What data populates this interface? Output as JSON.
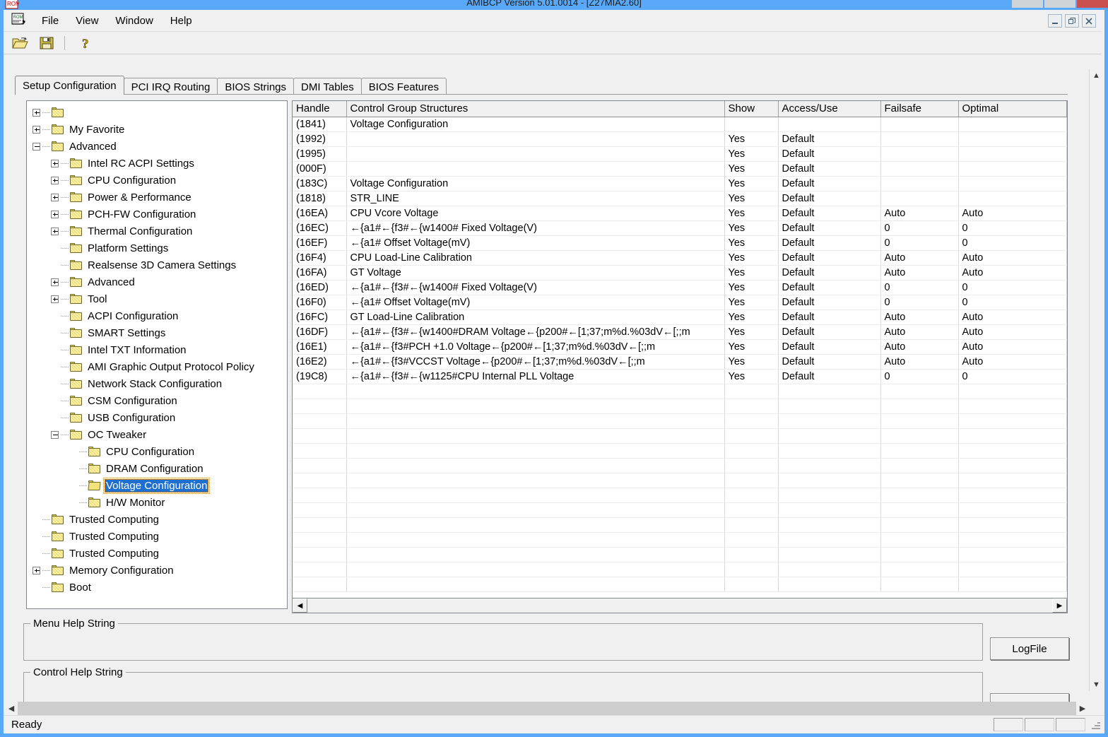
{
  "window": {
    "title": "AMIBCP Version 5.01.0014 - [Z27MIA2.60]",
    "app_icon": "rom-icon",
    "outer_buttons": [
      {
        "name": "minimize",
        "glyph": "–"
      },
      {
        "name": "maximize",
        "glyph": "❐"
      },
      {
        "name": "close",
        "glyph": "✕"
      }
    ]
  },
  "menu": {
    "doc_icon_label": "ROM",
    "items": [
      {
        "label": "File"
      },
      {
        "label": "View"
      },
      {
        "label": "Window"
      },
      {
        "label": "Help"
      }
    ]
  },
  "mdi_buttons": [
    {
      "name": "mdi-minimize",
      "glyph": "–"
    },
    {
      "name": "mdi-restore",
      "glyph": "❐"
    },
    {
      "name": "mdi-close",
      "glyph": "✕"
    }
  ],
  "toolbar": {
    "buttons": [
      {
        "name": "open-file-button",
        "icon": "open-folder-icon"
      },
      {
        "name": "save-file-button",
        "icon": "floppy-disk-icon"
      },
      {
        "name": "about-button",
        "icon": "question-mark-icon"
      }
    ]
  },
  "tabs": [
    {
      "label": "Setup Configuration",
      "active": true
    },
    {
      "label": "PCI IRQ Routing",
      "active": false
    },
    {
      "label": "BIOS Strings",
      "active": false
    },
    {
      "label": "DMI Tables",
      "active": false
    },
    {
      "label": "BIOS Features",
      "active": false
    }
  ],
  "tree": [
    {
      "label": "",
      "depth": 0,
      "toggle": "plus",
      "selected": false,
      "open": false
    },
    {
      "label": "My Favorite",
      "depth": 0,
      "toggle": "plus",
      "selected": false,
      "open": false
    },
    {
      "label": "Advanced",
      "depth": 0,
      "toggle": "minus",
      "selected": false,
      "open": false
    },
    {
      "label": "Intel RC ACPI Settings",
      "depth": 1,
      "toggle": "plus",
      "selected": false,
      "open": false
    },
    {
      "label": "CPU Configuration",
      "depth": 1,
      "toggle": "plus",
      "selected": false,
      "open": false
    },
    {
      "label": "Power & Performance",
      "depth": 1,
      "toggle": "plus",
      "selected": false,
      "open": false
    },
    {
      "label": "PCH-FW Configuration",
      "depth": 1,
      "toggle": "plus",
      "selected": false,
      "open": false
    },
    {
      "label": "Thermal Configuration",
      "depth": 1,
      "toggle": "plus",
      "selected": false,
      "open": false
    },
    {
      "label": "Platform Settings",
      "depth": 1,
      "toggle": "none",
      "selected": false,
      "open": false
    },
    {
      "label": "Realsense 3D Camera Settings",
      "depth": 1,
      "toggle": "none",
      "selected": false,
      "open": false
    },
    {
      "label": "Advanced",
      "depth": 1,
      "toggle": "plus",
      "selected": false,
      "open": false
    },
    {
      "label": "Tool",
      "depth": 1,
      "toggle": "plus",
      "selected": false,
      "open": false
    },
    {
      "label": "ACPI Configuration",
      "depth": 1,
      "toggle": "none",
      "selected": false,
      "open": false
    },
    {
      "label": "SMART Settings",
      "depth": 1,
      "toggle": "none",
      "selected": false,
      "open": false
    },
    {
      "label": "Intel TXT Information",
      "depth": 1,
      "toggle": "none",
      "selected": false,
      "open": false
    },
    {
      "label": "AMI Graphic Output Protocol Policy",
      "depth": 1,
      "toggle": "none",
      "selected": false,
      "open": false
    },
    {
      "label": "Network Stack Configuration",
      "depth": 1,
      "toggle": "none",
      "selected": false,
      "open": false
    },
    {
      "label": "CSM Configuration",
      "depth": 1,
      "toggle": "none",
      "selected": false,
      "open": false
    },
    {
      "label": "USB Configuration",
      "depth": 1,
      "toggle": "none",
      "selected": false,
      "open": false
    },
    {
      "label": "OC Tweaker",
      "depth": 1,
      "toggle": "minus",
      "selected": false,
      "open": false
    },
    {
      "label": "CPU Configuration",
      "depth": 2,
      "toggle": "none",
      "selected": false,
      "open": false
    },
    {
      "label": "DRAM Configuration",
      "depth": 2,
      "toggle": "none",
      "selected": false,
      "open": false
    },
    {
      "label": "Voltage Configuration",
      "depth": 2,
      "toggle": "none",
      "selected": true,
      "open": true
    },
    {
      "label": "H/W Monitor",
      "depth": 2,
      "toggle": "none",
      "selected": false,
      "open": false
    },
    {
      "label": "Trusted Computing",
      "depth": 0,
      "toggle": "none",
      "selected": false,
      "open": false
    },
    {
      "label": "Trusted Computing",
      "depth": 0,
      "toggle": "none",
      "selected": false,
      "open": false
    },
    {
      "label": "Trusted Computing",
      "depth": 0,
      "toggle": "none",
      "selected": false,
      "open": false
    },
    {
      "label": "Memory Configuration",
      "depth": 0,
      "toggle": "plus",
      "selected": false,
      "open": false
    },
    {
      "label": "Boot",
      "depth": 0,
      "toggle": "none",
      "selected": false,
      "open": false
    }
  ],
  "table": {
    "columns": [
      "Handle",
      "Control Group Structures",
      "Show",
      "Access/Use",
      "Failsafe",
      "Optimal"
    ],
    "rows": [
      [
        "(1841)",
        "Voltage Configuration",
        "",
        "",
        "",
        ""
      ],
      [
        "(1992)",
        "",
        "Yes",
        "Default",
        "",
        ""
      ],
      [
        "(1995)",
        "",
        "Yes",
        "Default",
        "",
        ""
      ],
      [
        "(000F)",
        "",
        "Yes",
        "Default",
        "",
        ""
      ],
      [
        "(183C)",
        "Voltage Configuration",
        "Yes",
        "Default",
        "",
        ""
      ],
      [
        "(1818)",
        "STR_LINE",
        "Yes",
        "Default",
        "",
        ""
      ],
      [
        "(16EA)",
        "CPU Vcore Voltage",
        "Yes",
        "Default",
        "Auto",
        "Auto"
      ],
      [
        "(16EC)",
        "←{a1#←{f3#←{w1400#  Fixed Voltage(V)",
        "Yes",
        "Default",
        "0",
        "0"
      ],
      [
        "(16EF)",
        "←{a1# Offset Voltage(mV)",
        "Yes",
        "Default",
        "0",
        "0"
      ],
      [
        "(16F4)",
        "CPU Load-Line Calibration",
        "Yes",
        "Default",
        "Auto",
        "Auto"
      ],
      [
        "(16FA)",
        "GT Voltage",
        "Yes",
        "Default",
        "Auto",
        "Auto"
      ],
      [
        "(16ED)",
        "←{a1#←{f3#←{w1400#  Fixed Voltage(V)",
        "Yes",
        "Default",
        "0",
        "0"
      ],
      [
        "(16F0)",
        "←{a1# Offset Voltage(mV)",
        "Yes",
        "Default",
        "0",
        "0"
      ],
      [
        "(16FC)",
        "GT Load-Line Calibration",
        "Yes",
        "Default",
        "Auto",
        "Auto"
      ],
      [
        "(16DF)",
        "←{a1#←{f3#←{w1400#DRAM Voltage←{p200#←[1;37;m%d.%03dV←[;;m",
        "Yes",
        "Default",
        "Auto",
        "Auto"
      ],
      [
        "(16E1)",
        "←{a1#←{f3#PCH +1.0 Voltage←{p200#←[1;37;m%d.%03dV←[;;m",
        "Yes",
        "Default",
        "Auto",
        "Auto"
      ],
      [
        "(16E2)",
        "←{a1#←{f3#VCCST Voltage←{p200#←[1;37;m%d.%03dV←[;;m",
        "Yes",
        "Default",
        "Auto",
        "Auto"
      ],
      [
        "(19C8)",
        "←{a1#←{f3#←{w1125#CPU Internal PLL Voltage",
        "Yes",
        "Default",
        "0",
        "0"
      ]
    ]
  },
  "bottom": {
    "menu_help_title": "Menu Help String",
    "menu_help_value": "",
    "control_help_title": "Control Help String",
    "control_help_value": "",
    "logfile_label": "LogFile"
  },
  "statusbar": {
    "text": "Ready",
    "panes": [
      "",
      "",
      ""
    ]
  }
}
